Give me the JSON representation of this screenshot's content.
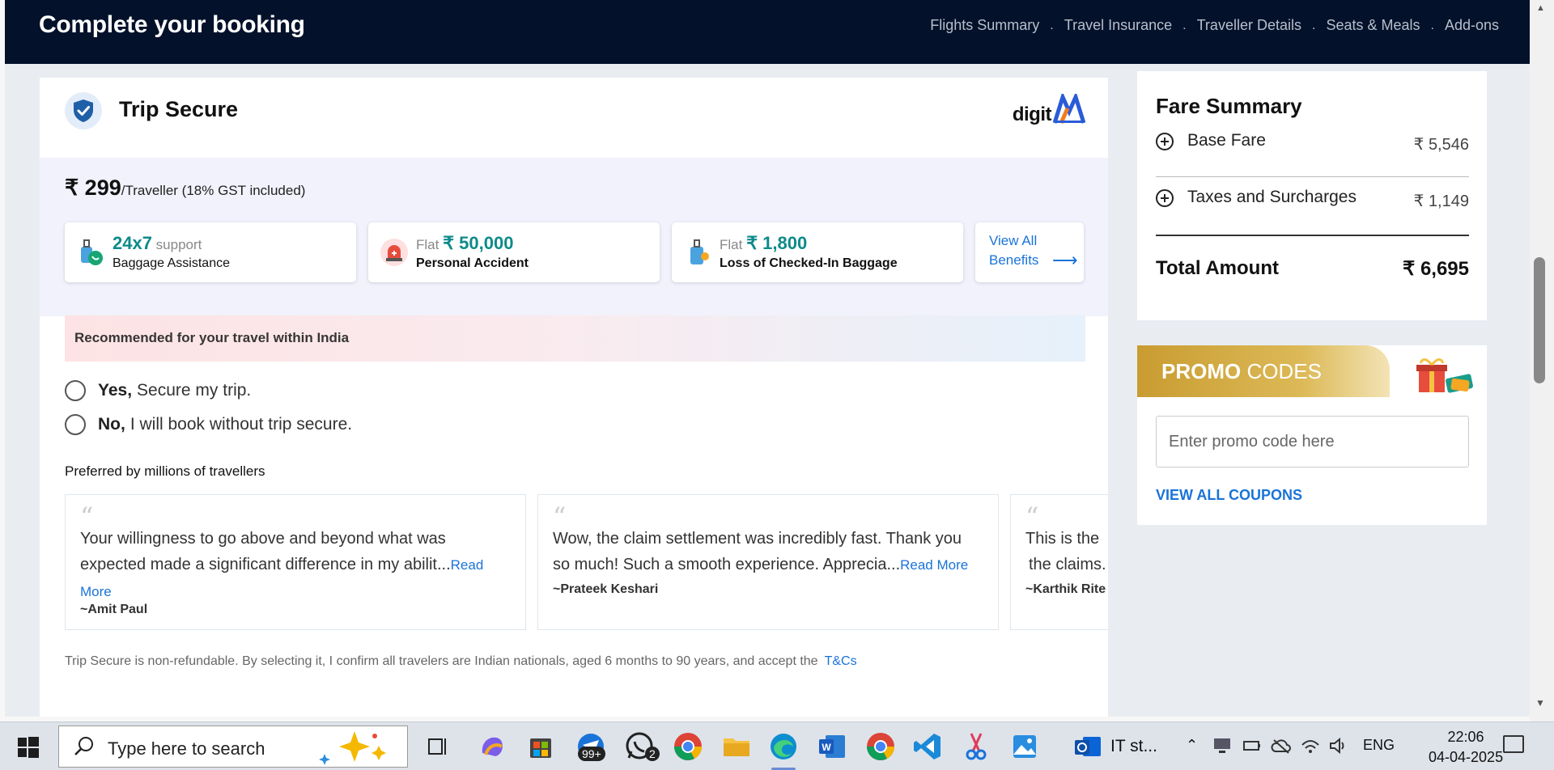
{
  "header": {
    "title": "Complete your booking",
    "steps": [
      "Flights Summary",
      "Travel Insurance",
      "Traveller Details",
      "Seats & Meals",
      "Add-ons"
    ],
    "separator": "."
  },
  "trip_secure": {
    "title": "Trip Secure",
    "partner_logo_text": "digit",
    "price_amount": "₹ 299",
    "price_suffix": "/Traveller (18% GST included)",
    "benefits": [
      {
        "highlight": "24x7",
        "prefix": "",
        "suffix": " support",
        "label": "Baggage Assistance",
        "icon": "baggage-support-icon"
      },
      {
        "highlight": "₹ 50,000",
        "prefix": "Flat ",
        "suffix": "",
        "label": "Personal Accident",
        "icon": "ambulance-siren-icon"
      },
      {
        "highlight": "₹ 1,800",
        "prefix": "Flat ",
        "suffix": "",
        "label": "Loss of Checked-In Baggage",
        "icon": "luggage-icon"
      }
    ],
    "view_all_line1": "View All",
    "view_all_line2": "Benefits",
    "view_all_arrow": "⟶",
    "recommendation": "Recommended for your travel within India",
    "options": [
      {
        "bold": "Yes,",
        "rest": "Secure my trip.",
        "selected": false
      },
      {
        "bold": "No,",
        "rest": "I will book without trip secure.",
        "selected": false
      }
    ],
    "preferred_heading": "Preferred by millions of travellers",
    "reviews": [
      {
        "quote_mark": "“",
        "text": "Your willingness to go above and beyond what was expected made a significant difference in my abilit...",
        "read_more": "Read More",
        "author": "~Amit Paul"
      },
      {
        "quote_mark": "“",
        "text": "Wow, the claim settlement was incredibly fast. Thank you so much! Such a smooth experience. Apprecia...",
        "read_more": "Read More",
        "author": "~Prateek Keshari"
      },
      {
        "quote_mark": "“",
        "text": "This is the  the claims.",
        "read_more": "",
        "author": "~Karthik Rite"
      }
    ],
    "disclaimer": "Trip Secure is non-refundable. By selecting it, I confirm all travelers are Indian nationals, aged 6 months to 90 years, and accept the",
    "tnc_link": "T&Cs"
  },
  "fare_summary": {
    "title": "Fare Summary",
    "rows": [
      {
        "label": "Base Fare",
        "value": "₹ 5,546"
      },
      {
        "label": "Taxes and Surcharges",
        "value": "₹ 1,149"
      }
    ],
    "total_label": "Total Amount",
    "total_value": "₹ 6,695"
  },
  "promo": {
    "title_bold": "PROMO",
    "title_rest": " CODES",
    "placeholder": "Enter promo code here",
    "view_all": "VIEW ALL COUPONS"
  },
  "taskbar": {
    "search_placeholder": "Type here to search",
    "mail_badge": "99+",
    "whatsapp_badge": "2",
    "active_window_label": "IT st...",
    "language": "ENG",
    "time": "22:06",
    "date": "04-04-2025"
  },
  "colors": {
    "header_bg": "#04112a",
    "accent_teal": "#0e8a8a",
    "link_blue": "#1a73d9",
    "promo_gold": "#c99c31"
  }
}
